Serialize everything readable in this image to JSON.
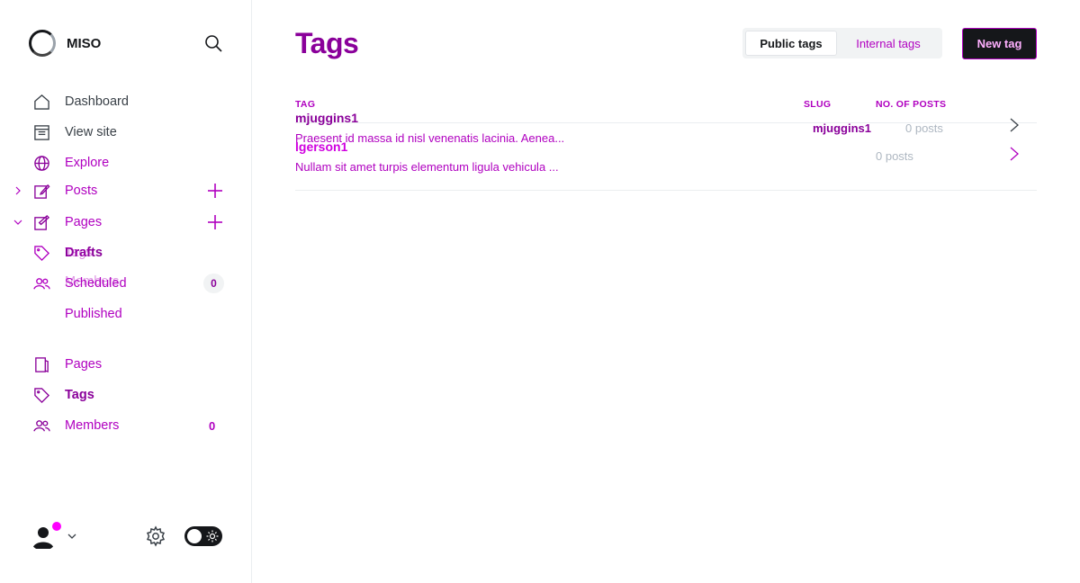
{
  "brand": {
    "name": "MISO"
  },
  "sidebar": {
    "items": [
      {
        "label": "Dashboard"
      },
      {
        "label": "View site"
      },
      {
        "label": "Explore"
      },
      {
        "label": "Posts"
      },
      {
        "label": "Pages"
      },
      {
        "label": "Drafts"
      },
      {
        "label": "Scheduled"
      },
      {
        "label": "Published"
      },
      {
        "label": "Pages"
      },
      {
        "label": "Tags"
      },
      {
        "label": "Members",
        "count": "0"
      }
    ],
    "ghost_labels": {
      "tags": "Tags",
      "members": "Members",
      "members_count": "0"
    }
  },
  "main": {
    "title": "Tags",
    "filters": {
      "public": "Public tags",
      "internal": "Internal tags"
    },
    "new_button": "New tag",
    "columns": {
      "tag": "TAG",
      "slug": "SLUG",
      "posts": "NO. OF POSTS"
    },
    "rows": [
      {
        "name": "mjuggins1",
        "description": "Praesent id massa id nisl venenatis lacinia. Aenea...",
        "slug": "mjuggins1",
        "posts": "0 posts"
      },
      {
        "name": "lgerson1",
        "description": "Nullam sit amet turpis elementum ligula vehicula ...",
        "slug": "",
        "posts": "0 posts"
      }
    ]
  },
  "colors": {
    "accent": "#b000c0",
    "dark": "#15171a"
  }
}
